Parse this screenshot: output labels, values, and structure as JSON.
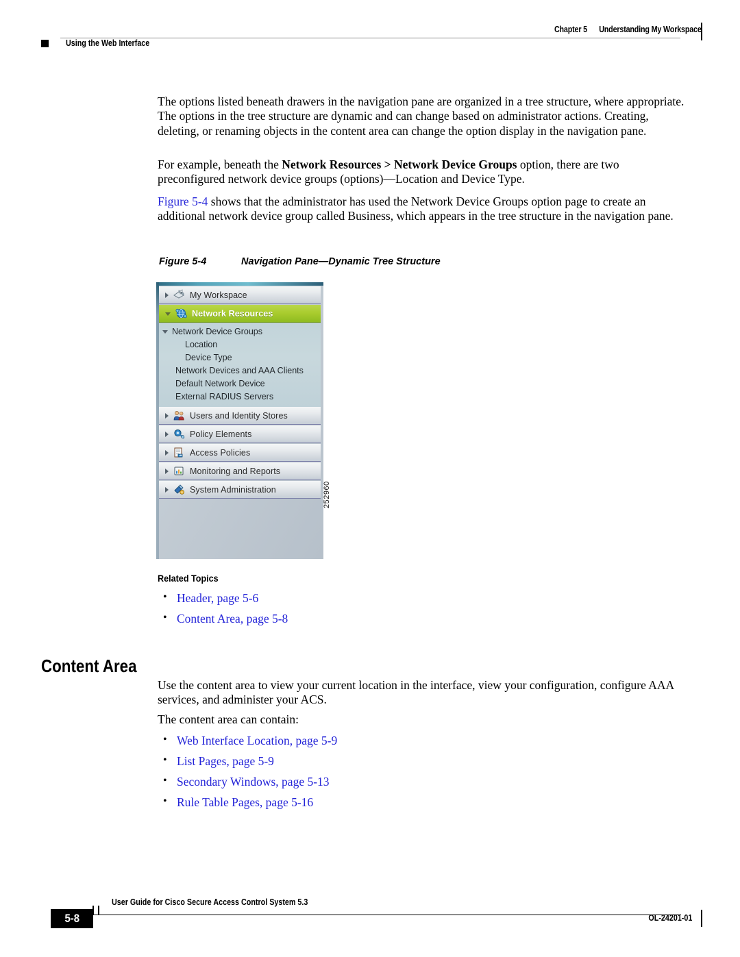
{
  "header": {
    "chapter": "Chapter 5",
    "chapter_title": "Understanding My Workspace",
    "left_title": "Using the Web Interface"
  },
  "body": {
    "para1": "The options listed beneath drawers in the navigation pane are organized in a tree structure, where appropriate. The options in the tree structure are dynamic and can change based on administrator actions. Creating, deleting, or renaming objects in the content area can change the option display in the navigation pane.",
    "para2_pre": "For example, beneath the ",
    "para2_bold": "Network Resources > Network Device Groups",
    "para2_post": " option, there are two preconfigured network device groups (options)—Location and Device Type.",
    "para3_link": "Figure 5-4",
    "para3_post": " shows that the administrator has used the Network Device Groups option page to create an additional network device group called Business, which appears in the tree structure in the navigation pane."
  },
  "figure": {
    "number": "Figure 5-4",
    "title": "Navigation Pane—Dynamic Tree Structure",
    "id": "252960",
    "nav_pane": {
      "drawers": [
        {
          "label": "My Workspace",
          "icon": "workspace-icon",
          "expanded": false,
          "selected": false
        },
        {
          "label": "Network Resources",
          "icon": "network-resources-icon",
          "expanded": true,
          "selected": true
        },
        {
          "label": "Users and Identity Stores",
          "icon": "users-icon",
          "expanded": false,
          "selected": false
        },
        {
          "label": "Policy Elements",
          "icon": "policy-elements-icon",
          "expanded": false,
          "selected": false
        },
        {
          "label": "Access Policies",
          "icon": "access-policies-icon",
          "expanded": false,
          "selected": false
        },
        {
          "label": "Monitoring and Reports",
          "icon": "monitoring-reports-icon",
          "expanded": false,
          "selected": false
        },
        {
          "label": "System Administration",
          "icon": "system-administration-icon",
          "expanded": false,
          "selected": false
        }
      ],
      "subtree": [
        {
          "label": "Network Device Groups",
          "level": 1,
          "expanded": true
        },
        {
          "label": "Location",
          "level": 2,
          "expanded": false
        },
        {
          "label": "Device Type",
          "level": 2,
          "expanded": false
        },
        {
          "label": "Network Devices and AAA Clients",
          "level": 1,
          "expanded": false
        },
        {
          "label": "Default Network Device",
          "level": 1,
          "expanded": false
        },
        {
          "label": "External RADIUS Servers",
          "level": 1,
          "expanded": false
        }
      ]
    }
  },
  "related_topics": {
    "heading": "Related Topics",
    "links": [
      "Header, page 5-6",
      "Content Area, page 5-8"
    ]
  },
  "section": {
    "heading": "Content Area",
    "para1": "Use the content area to view your current location in the interface, view your configuration, configure AAA services, and administer your ACS.",
    "para2": "The content area can contain:",
    "links": [
      "Web Interface Location, page 5-9",
      "List Pages, page 5-9",
      "Secondary Windows, page 5-13",
      "Rule Table Pages, page 5-16"
    ]
  },
  "footer": {
    "page_number": "5-8",
    "guide_title": "User Guide for Cisco Secure Access Control System 5.3",
    "doc_number": "OL-24201-01"
  },
  "colors": {
    "link": "#2424d8",
    "selected_drawer": "#a8cd2f",
    "pane_border": "#1d3a56"
  }
}
